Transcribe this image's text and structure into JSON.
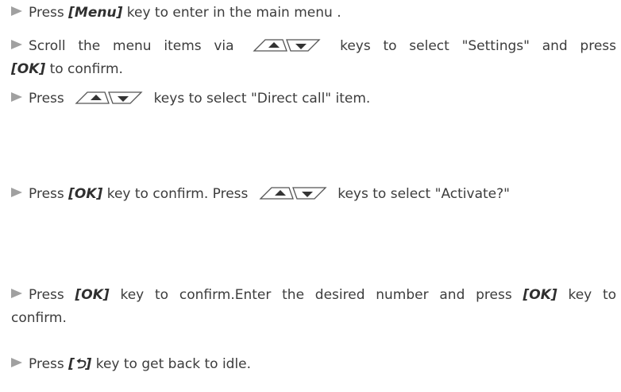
{
  "steps": [
    {
      "pre": "Press",
      "key": "[Menu]",
      "post": "key to enter in the main menu ."
    },
    {
      "line1_pre": "Scroll the menu items via",
      "line1_post": "keys to select \"Settings\" and press",
      "key": "[OK]",
      "post": "to confirm."
    },
    {
      "pre": "Press",
      "post": "keys to select  \"Direct call\" item."
    },
    {
      "pre": "Press",
      "key": "[OK]",
      "mid": "key to confirm. Press",
      "post": "keys to select \"Activate?\""
    },
    {
      "pre": "Press",
      "key": "[OK]",
      "mid": "key to confirm.Enter the desired number and press",
      "key2": "[OK]",
      "line1_post": "key to",
      "line2": "confirm."
    },
    {
      "pre": "Press",
      "key": "[⮌]",
      "post": "key to get back to idle."
    }
  ],
  "icons": {
    "bullet": "arrowhead-bullet",
    "nav": "up-down-navigation-keys",
    "back": "back-key-icon"
  }
}
